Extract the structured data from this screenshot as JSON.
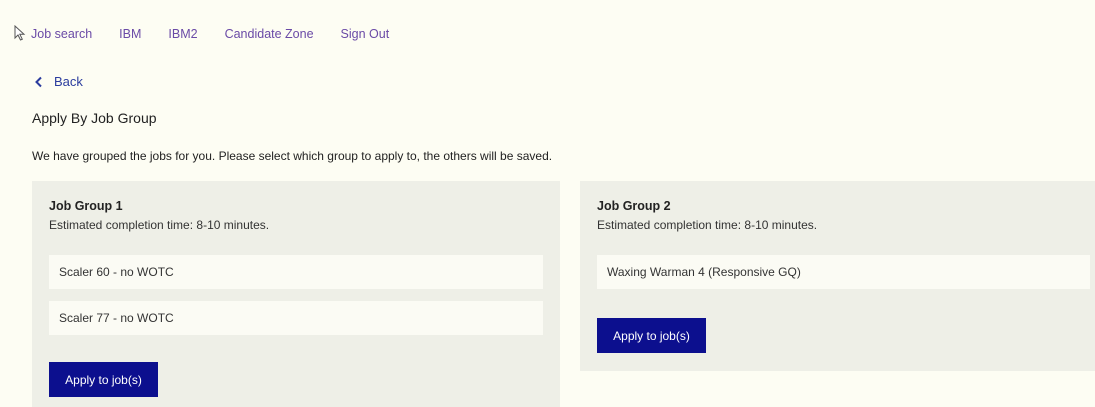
{
  "nav": {
    "links": [
      "Job search",
      "IBM",
      "IBM2",
      "Candidate Zone",
      "Sign Out"
    ]
  },
  "back_label": "Back",
  "page_title": "Apply By Job Group",
  "description": "We have grouped the jobs for you. Please select which group to apply to, the others will be saved.",
  "groups": [
    {
      "title": "Job Group 1",
      "estimate": "Estimated completion time: 8-10 minutes.",
      "jobs": [
        "Scaler 60 - no WOTC",
        "Scaler 77 - no WOTC"
      ],
      "apply_label": "Apply to job(s)"
    },
    {
      "title": "Job Group 2",
      "estimate": "Estimated completion time: 8-10 minutes.",
      "jobs": [
        "Waxing Warman 4 (Responsive GQ)"
      ],
      "apply_label": "Apply to job(s)"
    }
  ],
  "colors": {
    "link": "#6a4aa6",
    "back": "#2b3c9e",
    "button": "#0c0f8e",
    "group_bg": "#eeefe7",
    "page_bg": "#fdfdf3"
  },
  "icons": {
    "cursor": "pointer-cursor-icon",
    "back": "chevron-left-icon"
  }
}
